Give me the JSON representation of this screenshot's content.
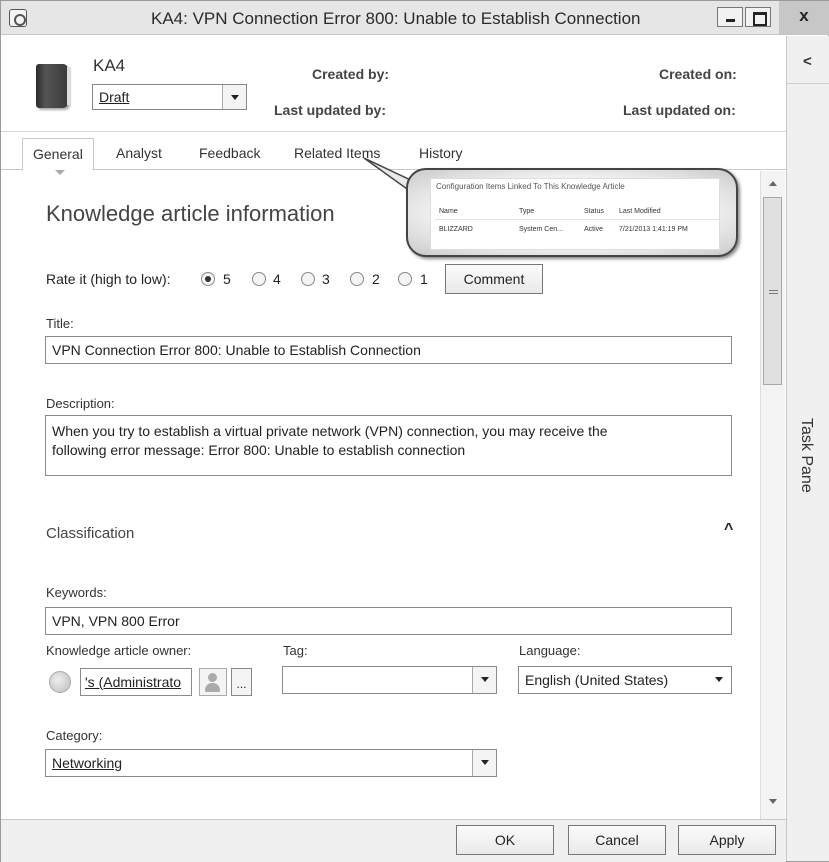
{
  "window": {
    "title": "KA4: VPN Connection Error 800: Unable to Establish Connection",
    "close_glyph": "x"
  },
  "header": {
    "ka_id": "KA4",
    "status_value": "Draft",
    "created_by_label": "Created by:",
    "last_updated_by_label": "Last updated by:",
    "created_on_label": "Created on:",
    "last_updated_on_label": "Last updated on:"
  },
  "tabs": [
    {
      "label": "General",
      "active": true
    },
    {
      "label": "Analyst"
    },
    {
      "label": "Feedback"
    },
    {
      "label": "Related Items"
    },
    {
      "label": "History"
    }
  ],
  "form": {
    "section_title": "Knowledge article information",
    "rate_label": "Rate it (high to low):",
    "rating_options": [
      "5",
      "4",
      "3",
      "2",
      "1"
    ],
    "rating_selected": "5",
    "comment_button": "Comment",
    "title_label": "Title:",
    "title_value": "VPN Connection Error 800: Unable to Establish Connection",
    "description_label": "Description:",
    "description_line1": "When you try to establish a virtual private network (VPN) connection, you may receive the",
    "description_line2": "following error message: Error 800: Unable to establish connection",
    "classification_title": "Classification",
    "collapse_glyph": "^",
    "keywords_label": "Keywords:",
    "keywords_value": "VPN, VPN 800 Error",
    "owner_label": "Knowledge article owner:",
    "owner_value": "'s (Administrato",
    "ellipsis_label": "...",
    "tag_label": "Tag:",
    "tag_value": "",
    "language_label": "Language:",
    "language_value": "English (United States)",
    "category_label": "Category:",
    "category_value": "Networking"
  },
  "footer": {
    "ok": "OK",
    "cancel": "Cancel",
    "apply": "Apply"
  },
  "task_pane": {
    "label": "Task Pane",
    "collapse_glyph": "<"
  },
  "callout": {
    "title": "Configuration Items Linked To This Knowledge Article",
    "columns": [
      "Name",
      "Type",
      "Status",
      "Last Modified"
    ],
    "row": [
      "BLIZZARD",
      "System Cen...",
      "Active",
      "7/21/2013 1:41:19 PM"
    ]
  }
}
